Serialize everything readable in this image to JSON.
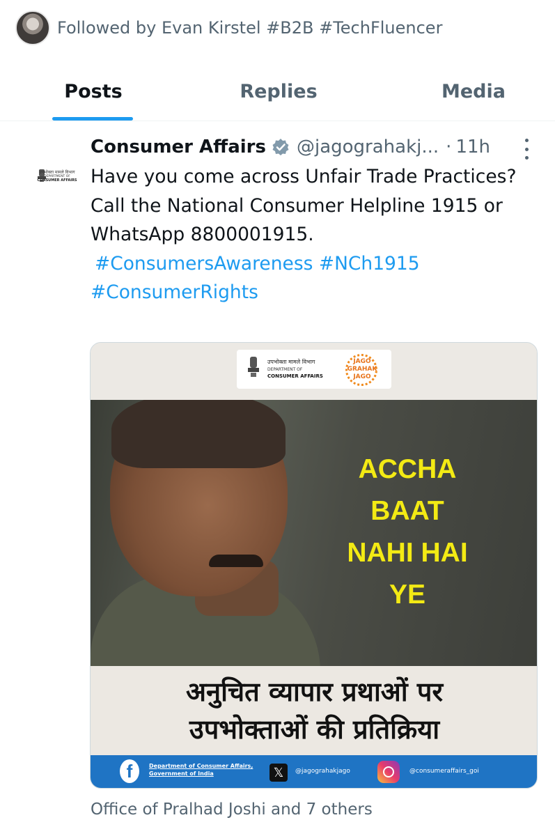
{
  "followed": {
    "text": "Followed by Evan Kirstel #B2B #TechFluencer"
  },
  "tabs": [
    {
      "label": "Posts",
      "active": true
    },
    {
      "label": "Replies",
      "active": false
    },
    {
      "label": "Media",
      "active": false
    }
  ],
  "post": {
    "author_name": "Consumer Affairs",
    "verified": true,
    "handle": "@jagograhakj...",
    "separator": "·",
    "time": "11h",
    "text_lines": [
      "Have you come across Unfair Trade Practices?",
      "Call the National Consumer Helpline 1915 or WhatsApp 8800001915."
    ],
    "hashtags": [
      "#ConsumersAwareness",
      "#NCh1915",
      "#ConsumerRights"
    ],
    "avatar_logo": {
      "hindi": "उपभोक्ता मामले विभाग",
      "line2": "DEPARTMENT OF",
      "line3": "CONSUMER AFFAIRS"
    },
    "media": {
      "logo_hindi": "उपभोक्ता मामले विभाग",
      "logo_dept": "DEPARTMENT OF",
      "logo_consumer": "CONSUMER AFFAIRS",
      "jago_lines": [
        "JAGO",
        "GRAHAK",
        "JAGO"
      ],
      "caption_lines": [
        "ACCHA",
        "BAAT",
        "NAHI HAI",
        "YE"
      ],
      "hindi_line1": "अनुचित व्यापार प्रथाओं पर",
      "hindi_line2": "उपभोक्ताओं की प्रतिक्रिया",
      "footer": {
        "fb_line1": "Department of Consumer Affairs,",
        "fb_line2": "Government of India",
        "x_handle": "@jagograhakjago",
        "ig_handle": "@consumeraffairs_goi"
      }
    },
    "social_context": "Office of Pralhad Joshi and 7 others"
  },
  "colors": {
    "accent": "#1d9bf0",
    "muted": "#536471",
    "caption_yellow": "#f3ea14",
    "footer_blue": "#1f74c4"
  },
  "icons": [
    "verified-badge-icon",
    "more-options-icon",
    "facebook-icon",
    "x-logo-icon",
    "instagram-icon"
  ]
}
